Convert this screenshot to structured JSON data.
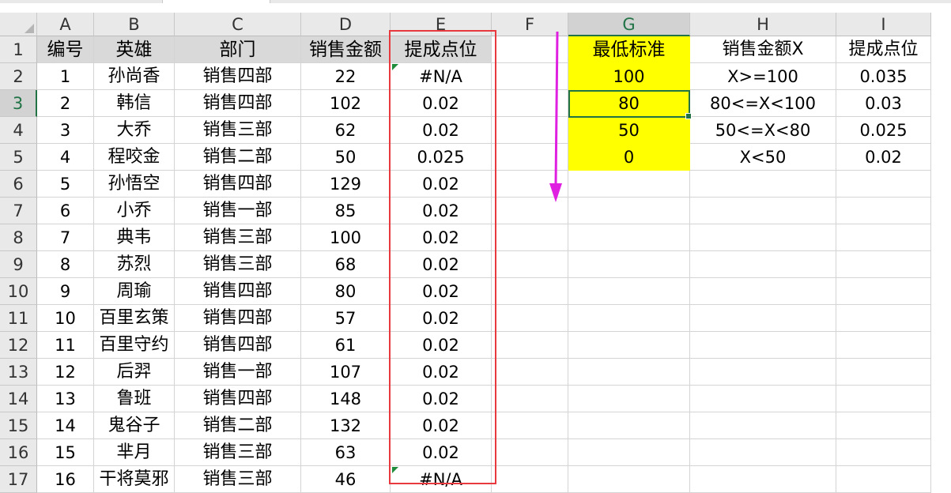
{
  "columns": [
    "A",
    "B",
    "C",
    "D",
    "E",
    "F",
    "G",
    "H",
    "I"
  ],
  "selected_column": "G",
  "selected_row": 3,
  "header_row": {
    "A": "编号",
    "B": "英雄",
    "C": "部门",
    "D": "销售金额",
    "E": "提成点位",
    "G": "最低标准",
    "H": "销售金额X",
    "I": "提成点位"
  },
  "rows": [
    {
      "row": "2",
      "A": "1",
      "B": "孙尚香",
      "C": "销售四部",
      "D": "22",
      "E": "#N/A",
      "G": "100",
      "H": "X>=100",
      "I": "0.035"
    },
    {
      "row": "3",
      "A": "2",
      "B": "韩信",
      "C": "销售四部",
      "D": "102",
      "E": "0.02",
      "G": "80",
      "H": "80<=X<100",
      "I": "0.03"
    },
    {
      "row": "4",
      "A": "3",
      "B": "大乔",
      "C": "销售三部",
      "D": "62",
      "E": "0.02",
      "G": "50",
      "H": "50<=X<80",
      "I": "0.025"
    },
    {
      "row": "5",
      "A": "4",
      "B": "程咬金",
      "C": "销售二部",
      "D": "50",
      "E": "0.025",
      "G": "0",
      "H": "X<50",
      "I": "0.02"
    },
    {
      "row": "6",
      "A": "5",
      "B": "孙悟空",
      "C": "销售四部",
      "D": "129",
      "E": "0.02"
    },
    {
      "row": "7",
      "A": "6",
      "B": "小乔",
      "C": "销售一部",
      "D": "85",
      "E": "0.02"
    },
    {
      "row": "8",
      "A": "7",
      "B": "典韦",
      "C": "销售三部",
      "D": "100",
      "E": "0.02"
    },
    {
      "row": "9",
      "A": "8",
      "B": "苏烈",
      "C": "销售三部",
      "D": "68",
      "E": "0.02"
    },
    {
      "row": "10",
      "A": "9",
      "B": "周瑜",
      "C": "销售四部",
      "D": "80",
      "E": "0.02"
    },
    {
      "row": "11",
      "A": "10",
      "B": "百里玄策",
      "C": "销售四部",
      "D": "57",
      "E": "0.02"
    },
    {
      "row": "12",
      "A": "11",
      "B": "百里守约",
      "C": "销售四部",
      "D": "61",
      "E": "0.02"
    },
    {
      "row": "13",
      "A": "12",
      "B": "后羿",
      "C": "销售一部",
      "D": "107",
      "E": "0.02"
    },
    {
      "row": "14",
      "A": "13",
      "B": "鲁班",
      "C": "销售四部",
      "D": "148",
      "E": "0.02"
    },
    {
      "row": "15",
      "A": "14",
      "B": "鬼谷子",
      "C": "销售二部",
      "D": "132",
      "E": "0.02"
    },
    {
      "row": "16",
      "A": "15",
      "B": "芈月",
      "C": "销售三部",
      "D": "63",
      "E": "0.02"
    },
    {
      "row": "17",
      "A": "16",
      "B": "干将莫邪",
      "C": "销售三部",
      "D": "46",
      "E": "#N/A"
    }
  ],
  "colors": {
    "header_fill": "#d9d9d9",
    "highlight_fill": "#ffff00",
    "selection": "#217346",
    "annotation_box": "#e8393f",
    "annotation_arrow": "#e020e0",
    "error_indicator": "#1e8c3a"
  }
}
